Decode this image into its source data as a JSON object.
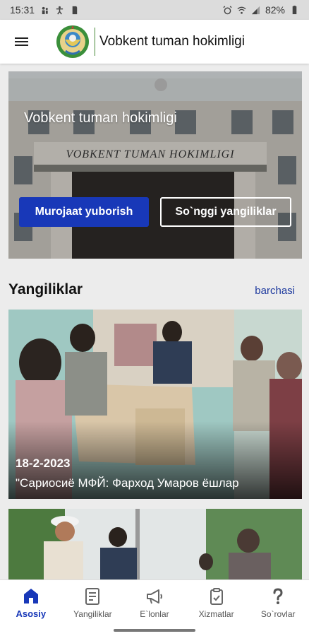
{
  "status_bar": {
    "time": "15:31",
    "battery": "82%"
  },
  "app_bar": {
    "title": "Vobkent tuman hokimligi"
  },
  "hero": {
    "title": "Vobkent tuman hokimligi",
    "building_sign": "VOBKENT TUMAN HOKIMLIGI",
    "primary_button": "Murojaat yuborish",
    "secondary_button": "So`nggi yangiliklar"
  },
  "news_section": {
    "title": "Yangiliklar",
    "see_all": "barchasi",
    "items": [
      {
        "date": "18-2-2023",
        "title": "\"Сариосиё МФЙ: Фарход Умаров ёшлар"
      },
      {
        "date": "",
        "title": ""
      }
    ]
  },
  "bottom_nav": {
    "items": [
      {
        "label": "Asosiy",
        "icon": "home-icon",
        "active": true
      },
      {
        "label": "Yangiliklar",
        "icon": "news-icon",
        "active": false
      },
      {
        "label": "E`lonlar",
        "icon": "megaphone-icon",
        "active": false
      },
      {
        "label": "Xizmatlar",
        "icon": "clipboard-check-icon",
        "active": false
      },
      {
        "label": "So`rovlar",
        "icon": "question-icon",
        "active": false
      }
    ]
  },
  "colors": {
    "primary": "#1838b8",
    "link": "#1e3a9e",
    "background": "#ececec"
  }
}
